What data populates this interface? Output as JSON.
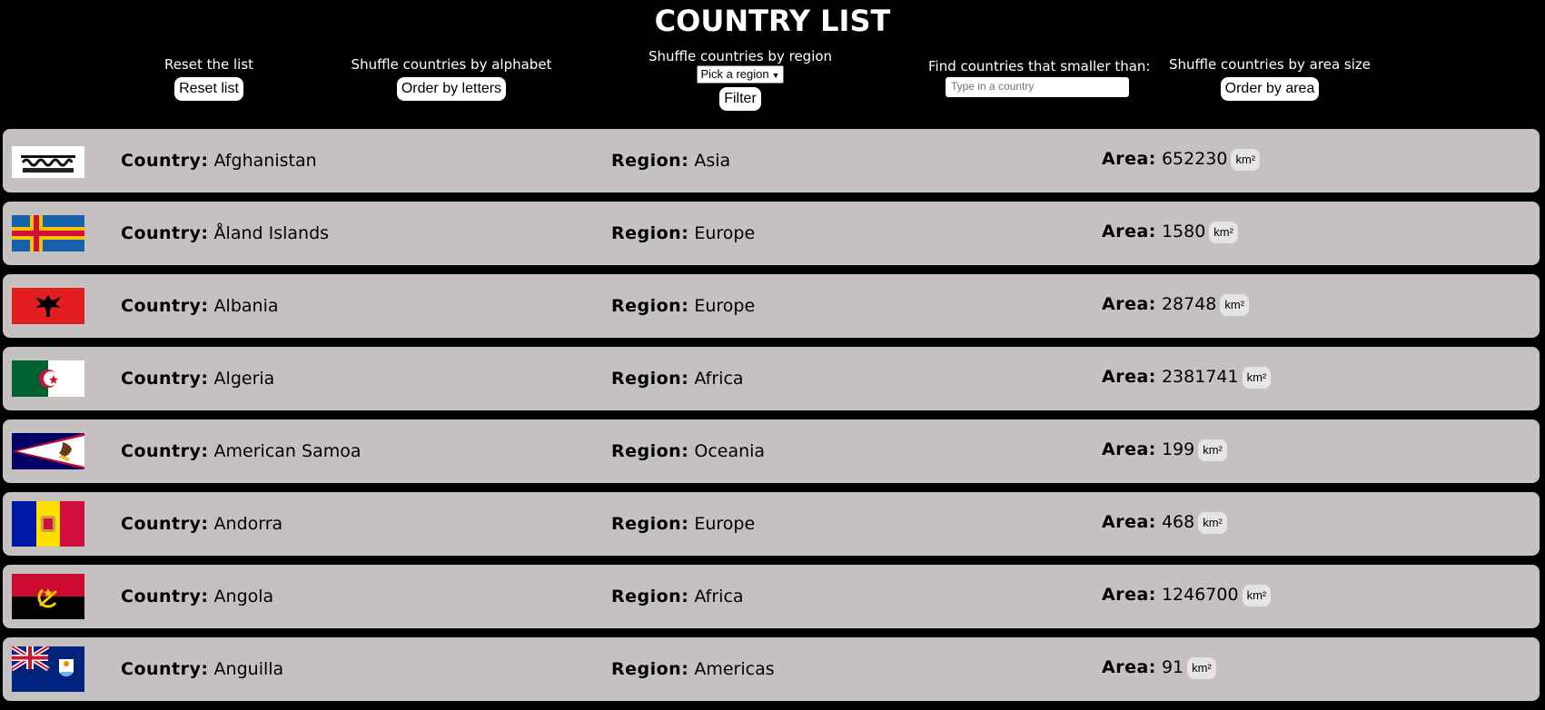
{
  "title": "COUNTRY LIST",
  "controls": {
    "reset": {
      "label": "Reset the list",
      "button": "Reset list"
    },
    "alphabet": {
      "label": "Shuffle countries by alphabet",
      "button": "Order by letters"
    },
    "region": {
      "label": "Shuffle countries by region",
      "select_value": "Pick a region",
      "button": "Filter"
    },
    "smaller": {
      "label": "Find countries that smaller than:",
      "placeholder": "Type in a country"
    },
    "area": {
      "label": "Shuffle countries by area size",
      "button": "Order by area"
    }
  },
  "labels": {
    "country": "Country:",
    "region": "Region:",
    "area": "Area:",
    "unit": "km²"
  },
  "countries": [
    {
      "name": "Afghanistan",
      "region": "Asia",
      "area": "652230",
      "flag": "afghanistan-flag"
    },
    {
      "name": "Åland Islands",
      "region": "Europe",
      "area": "1580",
      "flag": "aland-islands-flag"
    },
    {
      "name": "Albania",
      "region": "Europe",
      "area": "28748",
      "flag": "albania-flag"
    },
    {
      "name": "Algeria",
      "region": "Africa",
      "area": "2381741",
      "flag": "algeria-flag"
    },
    {
      "name": "American Samoa",
      "region": "Oceania",
      "area": "199",
      "flag": "american-samoa-flag"
    },
    {
      "name": "Andorra",
      "region": "Europe",
      "area": "468",
      "flag": "andorra-flag"
    },
    {
      "name": "Angola",
      "region": "Africa",
      "area": "1246700",
      "flag": "angola-flag"
    },
    {
      "name": "Anguilla",
      "region": "Americas",
      "area": "91",
      "flag": "anguilla-flag"
    }
  ]
}
